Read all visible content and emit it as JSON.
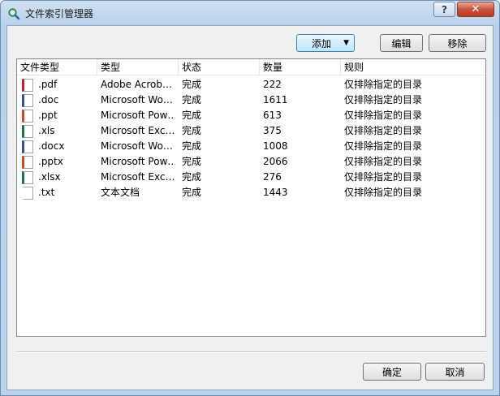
{
  "window": {
    "title": "文件索引管理器",
    "help_label": "?",
    "close_label": "✕"
  },
  "toolbar": {
    "add_label": "添加",
    "add_arrow": "▼",
    "edit_label": "编辑",
    "remove_label": "移除"
  },
  "table": {
    "columns": [
      "文件类型",
      "类型",
      "状态",
      "数量",
      "规则"
    ],
    "rows": [
      {
        "ext": ".pdf",
        "type": "Adobe Acrob…",
        "status": "完成",
        "count": "222",
        "rule": "仅排除指定的目录",
        "icon": "pdf-file-icon",
        "color": "#c0272d"
      },
      {
        "ext": ".doc",
        "type": "Microsoft Wo…",
        "status": "完成",
        "count": "1611",
        "rule": "仅排除指定的目录",
        "icon": "doc-file-icon",
        "color": "#2b579a"
      },
      {
        "ext": ".ppt",
        "type": "Microsoft Pow…",
        "status": "完成",
        "count": "613",
        "rule": "仅排除指定的目录",
        "icon": "ppt-file-icon",
        "color": "#d24726"
      },
      {
        "ext": ".xls",
        "type": "Microsoft Exc…",
        "status": "完成",
        "count": "375",
        "rule": "仅排除指定的目录",
        "icon": "xls-file-icon",
        "color": "#217346"
      },
      {
        "ext": ".docx",
        "type": "Microsoft Wo…",
        "status": "完成",
        "count": "1008",
        "rule": "仅排除指定的目录",
        "icon": "docx-file-icon",
        "color": "#2b579a"
      },
      {
        "ext": ".pptx",
        "type": "Microsoft Pow…",
        "status": "完成",
        "count": "2066",
        "rule": "仅排除指定的目录",
        "icon": "pptx-file-icon",
        "color": "#d24726"
      },
      {
        "ext": ".xlsx",
        "type": "Microsoft Exc…",
        "status": "完成",
        "count": "276",
        "rule": "仅排除指定的目录",
        "icon": "xlsx-file-icon",
        "color": "#217346"
      },
      {
        "ext": ".txt",
        "type": "文本文档",
        "status": "完成",
        "count": "1443",
        "rule": "仅排除指定的目录",
        "icon": "txt-file-icon",
        "color": "#ffffff"
      }
    ]
  },
  "footer": {
    "ok_label": "确定",
    "cancel_label": "取消"
  }
}
